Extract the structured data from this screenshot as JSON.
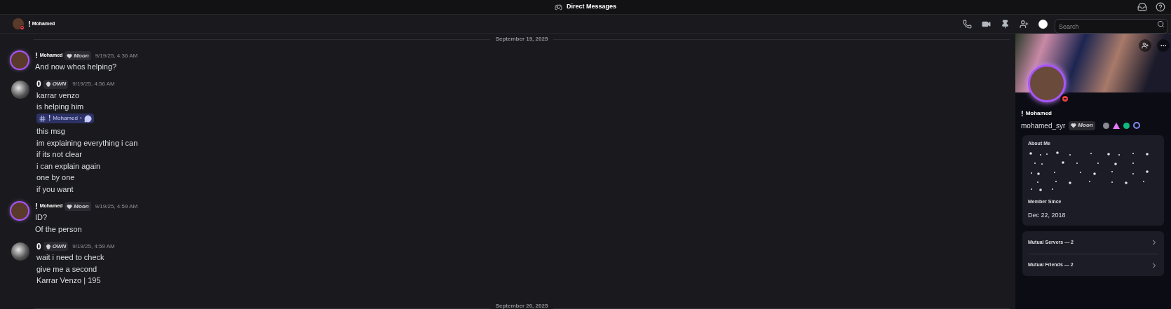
{
  "title_bar": {
    "title": "Direct Messages"
  },
  "header": {
    "name_prefix": "!",
    "name": "Mohamed",
    "do_not_disturb": true,
    "search": {
      "placeholder": "Search"
    }
  },
  "chat": {
    "dividers": [
      {
        "label": "September 19, 2025"
      },
      {
        "label": "September 20, 2025"
      }
    ],
    "groups": [
      {
        "avatar_ring": true,
        "name_prefix": "!",
        "name": "Mohamed",
        "badge": {
          "kind": "heart",
          "label": "Moon"
        },
        "time": "9/19/25, 4:36 AM",
        "lines": [
          {
            "kind": "text",
            "text": "And now whos helping?"
          }
        ]
      },
      {
        "avatar_ring": false,
        "name": "0",
        "badge": {
          "kind": "skull",
          "label": "OWN"
        },
        "time": "9/19/25, 4:56 AM",
        "lines": [
          {
            "kind": "text",
            "text": "karrar venzo"
          },
          {
            "kind": "text",
            "text": "is helping him"
          },
          {
            "kind": "thread",
            "prefix": "!",
            "text": "Mohamed",
            "sep": "›"
          },
          {
            "kind": "text",
            "text": "this msg"
          },
          {
            "kind": "text",
            "text": "im explaining everything i can"
          },
          {
            "kind": "text",
            "text": "if its not clear"
          },
          {
            "kind": "text",
            "text": "i can explain again"
          },
          {
            "kind": "text",
            "text": "one by one"
          },
          {
            "kind": "text",
            "text": "if you want"
          }
        ]
      },
      {
        "avatar_ring": true,
        "name_prefix": "!",
        "name": "Mohamed",
        "badge": {
          "kind": "heart",
          "label": "Moon"
        },
        "time": "9/19/25, 4:59 AM",
        "lines": [
          {
            "kind": "text",
            "text": "ID?"
          },
          {
            "kind": "text",
            "text": "Of the person"
          }
        ]
      },
      {
        "avatar_ring": false,
        "name": "0",
        "badge": {
          "kind": "skull",
          "label": "OWN"
        },
        "time": "9/19/25, 4:59 AM",
        "lines": [
          {
            "kind": "text",
            "text": "wait i need to check"
          },
          {
            "kind": "text",
            "text": "give me a second"
          },
          {
            "kind": "text",
            "text": "Karrar Venzo | 195"
          }
        ]
      }
    ]
  },
  "profile": {
    "name_prefix": "!",
    "display_name": "Mohamed",
    "username": "mohamed_syr",
    "do_not_disturb": true,
    "badge": {
      "kind": "heart",
      "label": "Moon"
    },
    "about": {
      "title": "About Me",
      "member_since_title": "Member Since",
      "member_since": "Dec 22, 2018"
    },
    "mutuals": [
      {
        "label": "Mutual Servers — 2"
      },
      {
        "label": "Mutual Friends — 2"
      }
    ]
  }
}
